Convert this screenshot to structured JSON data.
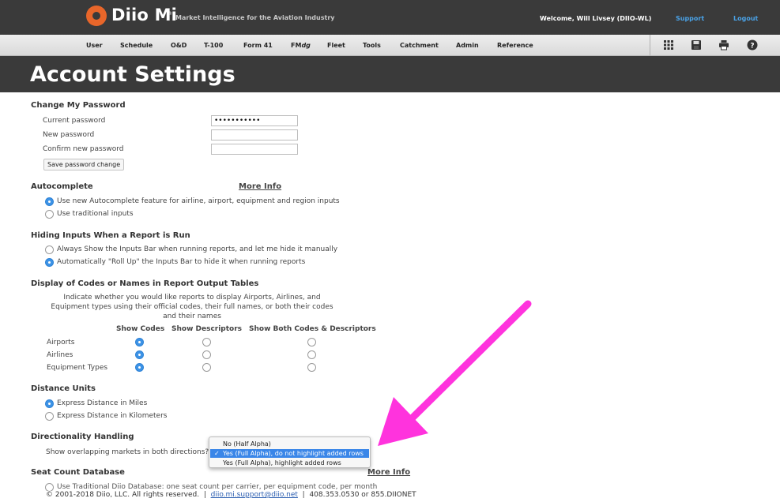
{
  "header": {
    "brand": "Diio Mi",
    "brand_mark": "®",
    "tagline": "Market Intelligence for the Aviation Industry",
    "welcome": "Welcome, Will Livsey (DIIO-WL)",
    "support": "Support",
    "logout": "Logout"
  },
  "nav": {
    "items": [
      "User",
      "Schedule",
      "O&D",
      "T-100",
      "Form 41",
      "FM",
      "dg",
      "Fleet",
      "Tools",
      "Catchment",
      "Admin",
      "Reference"
    ],
    "icons": [
      "grid-icon",
      "save-icon",
      "print-icon",
      "help-icon"
    ]
  },
  "page": {
    "title": "Account Settings"
  },
  "password": {
    "title": "Change My Password",
    "current_label": "Current password",
    "current_value": "•••••••••••",
    "new_label": "New password",
    "confirm_label": "Confirm new password",
    "save_button": "Save password change"
  },
  "autocomplete": {
    "title": "Autocomplete",
    "more_info": "More Info",
    "opt1": "Use new Autocomplete feature for airline, airport, equipment and region inputs",
    "opt2": "Use traditional inputs",
    "selected": 1
  },
  "hiding": {
    "title": "Hiding Inputs When a Report is Run",
    "opt1": "Always Show the Inputs Bar when running reports, and let me hide it manually",
    "opt2": "Automatically \"Roll Up\" the Inputs Bar to hide it when running reports",
    "selected": 2
  },
  "codes": {
    "title": "Display of Codes or Names in Report Output Tables",
    "desc1": "Indicate whether you would like reports to display Airports, Airlines, and",
    "desc2": "Equipment types using their official codes, their full names, or both their codes",
    "desc3": "and their names",
    "col1": "Show Codes",
    "col2": "Show Descriptors",
    "col3": "Show Both Codes & Descriptors",
    "row1": "Airports",
    "row2": "Airlines",
    "row3": "Equipment Types",
    "selected_column": 1
  },
  "distance": {
    "title": "Distance Units",
    "opt1": "Express Distance in Miles",
    "opt2": "Express Distance in Kilometers",
    "selected": 1
  },
  "directionality": {
    "title": "Directionality Handling",
    "question": "Show overlapping markets in both directions?",
    "options": [
      "No (Half Alpha)",
      "Yes (Full Alpha), do not highlight added rows",
      "Yes (Full Alpha), highlight added rows"
    ],
    "selected": 1,
    "check": "✓"
  },
  "seat": {
    "title": "Seat Count Database",
    "more_info": "More Info",
    "opt1": "Use Traditional Diio Database: one seat count per carrier, per equipment code, per month"
  },
  "footer": {
    "copyright": "© 2001-2018 Diio, LLC. All rights reserved.",
    "sep": "|",
    "email": "diio.mi.support@diio.net",
    "phone": "408.353.0530 or 855.DIIONET"
  },
  "colors": {
    "accent_arrow": "#ff33dd",
    "radio_on": "#3d93e6",
    "header_bg": "#3a3a3a"
  }
}
